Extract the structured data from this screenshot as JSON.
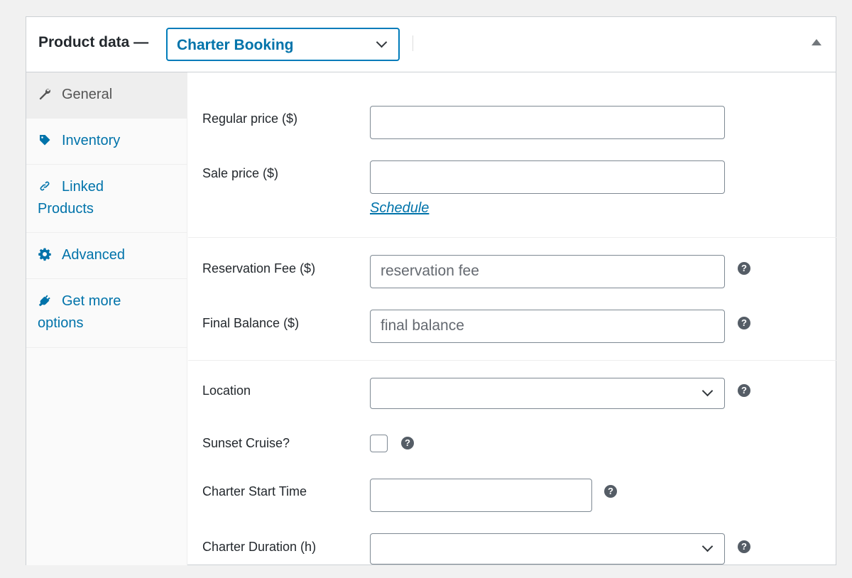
{
  "header": {
    "title": "Product data —",
    "product_type": "Charter Booking"
  },
  "tabs": [
    {
      "label_line1": "General",
      "label_line2": "",
      "icon": "wrench-icon",
      "active": true
    },
    {
      "label_line1": "Inventory",
      "label_line2": "",
      "icon": "tag-icon",
      "active": false
    },
    {
      "label_line1": "Linked",
      "label_line2": "Products",
      "icon": "link-icon",
      "active": false
    },
    {
      "label_line1": "Advanced",
      "label_line2": "",
      "icon": "gear-icon",
      "active": false
    },
    {
      "label_line1": "Get more",
      "label_line2": "options",
      "icon": "plugin-icon",
      "active": false
    }
  ],
  "fields": {
    "regular_price": {
      "label": "Regular price ($)",
      "value": ""
    },
    "sale_price": {
      "label": "Sale price ($)",
      "value": "",
      "schedule_link": "Schedule"
    },
    "reservation_fee": {
      "label": "Reservation Fee ($)",
      "placeholder": "reservation fee"
    },
    "final_balance": {
      "label": "Final Balance ($)",
      "placeholder": "final balance"
    },
    "location": {
      "label": "Location",
      "value": ""
    },
    "sunset_cruise": {
      "label": "Sunset Cruise?",
      "checked": false
    },
    "charter_start_time": {
      "label": "Charter Start Time",
      "value": ""
    },
    "charter_duration": {
      "label": "Charter Duration (h)",
      "value": ""
    }
  },
  "help_glyph": "?",
  "colors": {
    "link": "#0073aa",
    "focus_border": "#007cba",
    "help_bg": "#555d66"
  }
}
